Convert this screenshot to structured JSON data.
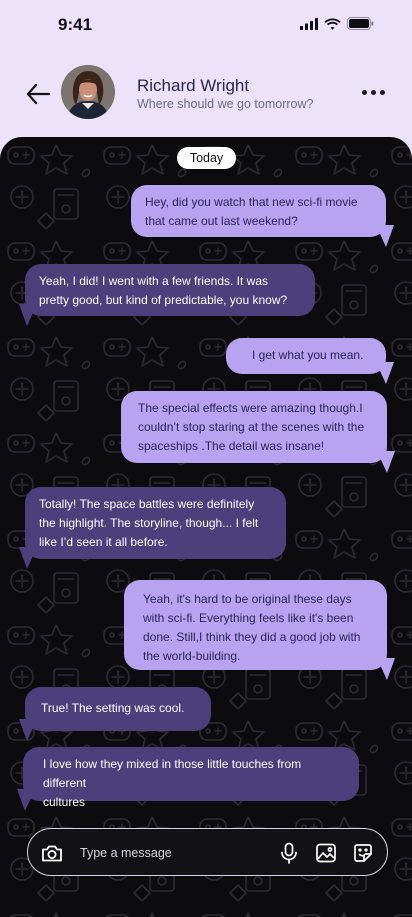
{
  "status_bar": {
    "time": "9:41"
  },
  "header": {
    "contact_name": "Richard Wright",
    "contact_status": "Where should we go tomorrow?"
  },
  "chat": {
    "day_label": "Today",
    "messages": [
      {
        "direction": "out",
        "line1": "Hey, did you watch that new sci-fi movie",
        "line2": "that came out last weekend?"
      },
      {
        "direction": "in",
        "line1": "Yeah, I did! I went with a few friends. It was",
        "line2": "pretty good, but kind of predictable, you know?"
      },
      {
        "direction": "out",
        "line1": "I get what you mean."
      },
      {
        "direction": "out",
        "line1": "The special effects were amazing though.I",
        "line2": "couldn’t stop staring at the scenes with the",
        "line3": "spaceships .The detail was insane!"
      },
      {
        "direction": "in",
        "line1": "Totally! The space battles were definitely",
        "line2": "the highlight. The storyline, though... I felt",
        "line3": "like I’d seen it all before."
      },
      {
        "direction": "out",
        "line1": "Yeah, it's hard to be original these days",
        "line2": "with sci-fi. Everything feels like it's been",
        "line3": "done. Still,I think they did a good job with",
        "line4": "the world-building."
      },
      {
        "direction": "in",
        "line1": "True! The setting was cool."
      },
      {
        "direction": "in",
        "line1": "I love how they mixed in those little touches from different",
        "line2": "cultures"
      }
    ]
  },
  "composer": {
    "placeholder": "Type a message"
  },
  "icons": {
    "back": "arrow-left-icon",
    "more": "more-horizontal-icon",
    "camera": "camera-icon",
    "mic": "microphone-icon",
    "gallery": "image-icon",
    "sticker": "sticker-icon"
  },
  "colors": {
    "header_bg": "#ece3fb",
    "chat_bg": "#0c0c0e",
    "outgoing_bubble": "#b7a3ef",
    "incoming_bubble": "#4b3f7c"
  }
}
